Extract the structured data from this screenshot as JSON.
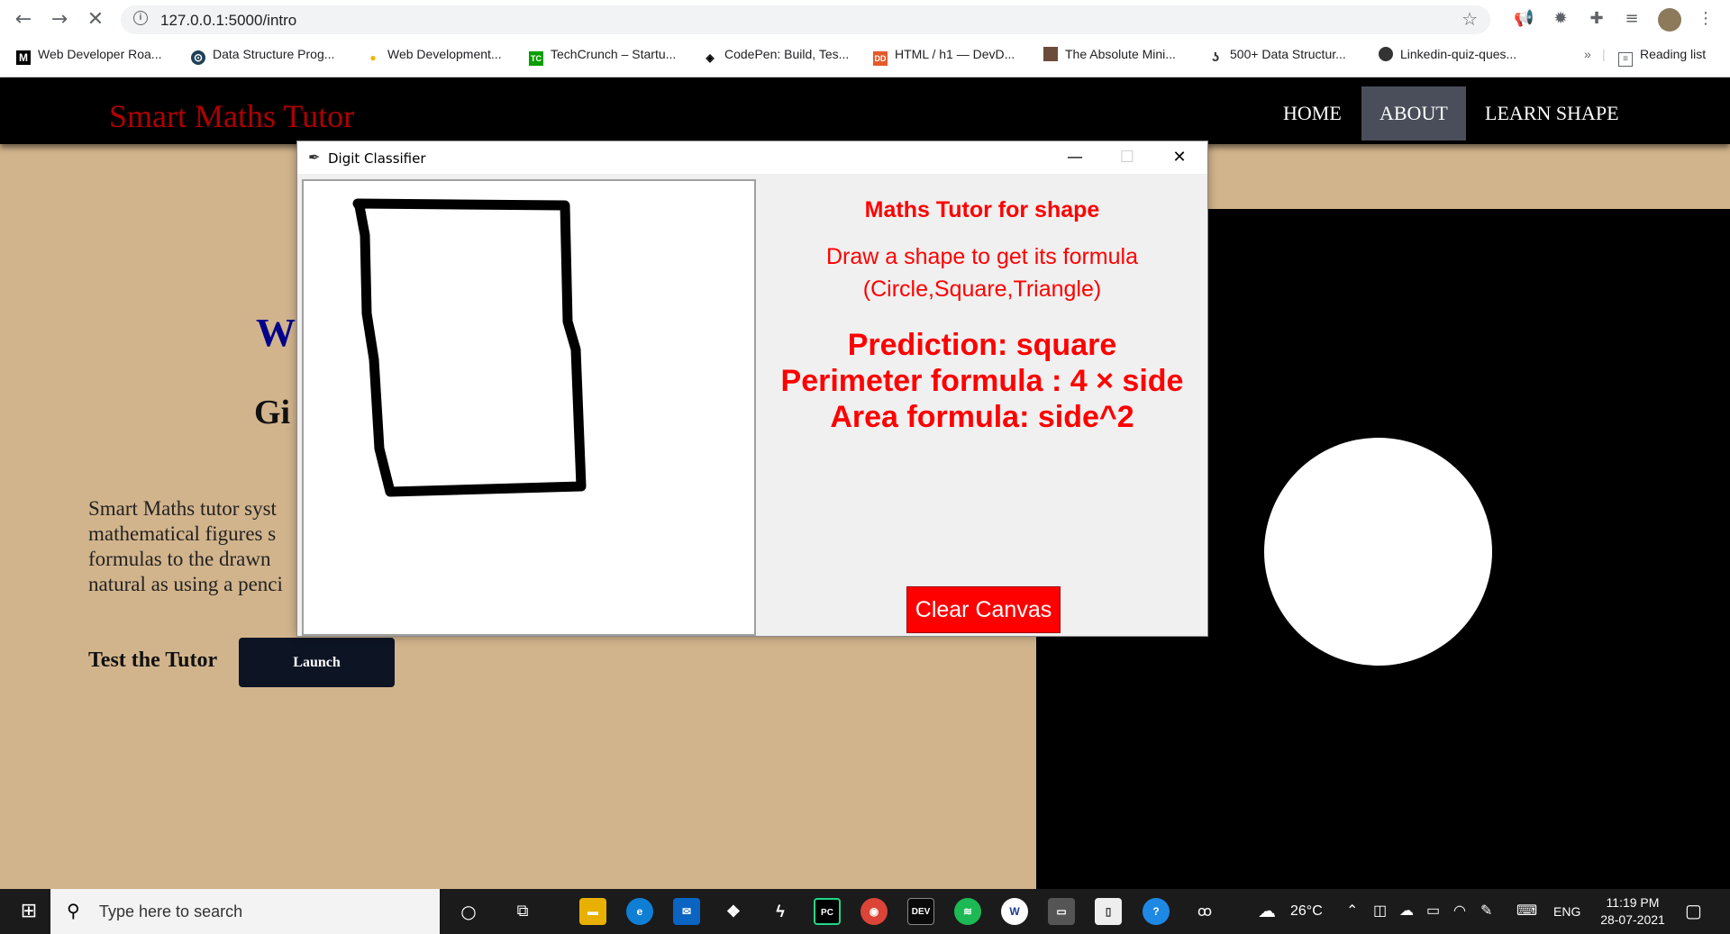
{
  "browser": {
    "url": "127.0.0.1:5000/intro",
    "bookmarks": [
      {
        "label": "Web Developer Roa...",
        "icon": "medium-icon",
        "color": "#000000"
      },
      {
        "label": "Data Structure Prog...",
        "icon": "codecademy-icon",
        "color": "#1f4056"
      },
      {
        "label": "Web Development...",
        "icon": "bulb-icon",
        "color": "#f5b400"
      },
      {
        "label": "TechCrunch – Startu...",
        "icon": "techcrunch-icon",
        "color": "#0a9e01"
      },
      {
        "label": "CodePen: Build, Tes...",
        "icon": "codepen-icon",
        "color": "#000000"
      },
      {
        "label": "HTML / h1 — DevD...",
        "icon": "devdocs-icon",
        "color": "#e35a2b"
      },
      {
        "label": "The Absolute Mini...",
        "icon": "avatar-icon",
        "color": "#6b4c3b"
      },
      {
        "label": "500+ Data Structur...",
        "icon": "bracket-icon",
        "color": "#333333"
      },
      {
        "label": "Linkedin-quiz-ques...",
        "icon": "github-icon",
        "color": "#333333"
      }
    ],
    "more_label": "»",
    "reading_list_label": "Reading list"
  },
  "site": {
    "brand": "Smart Maths Tutor",
    "nav": [
      "HOME",
      "ABOUT",
      "LEARN SHAPE"
    ],
    "hero_partial_w": "W",
    "hero_partial_g": "Gi",
    "paragraph_lines": [
      "Smart Maths tutor syst",
      "mathematical figures s",
      "formulas to the drawn",
      "natural as using a penci"
    ],
    "test_label": "Test the Tutor",
    "launch_label": "Launch"
  },
  "tk": {
    "window_title": "Digit Classifier",
    "heading": "Maths Tutor for shape",
    "instruction_line1": "Draw a shape to get its formula",
    "instruction_line2": "(Circle,Square,Triangle)",
    "prediction": "Prediction: square",
    "perimeter": "Perimeter formula : 4 × side",
    "area": "Area formula: side^2",
    "clear_label": "Clear Canvas",
    "accent": "#ff0000"
  },
  "taskbar": {
    "search_placeholder": "Type here to search",
    "weather": "26°C",
    "language": "ENG",
    "time": "11:19 PM",
    "date": "28-07-2021"
  }
}
